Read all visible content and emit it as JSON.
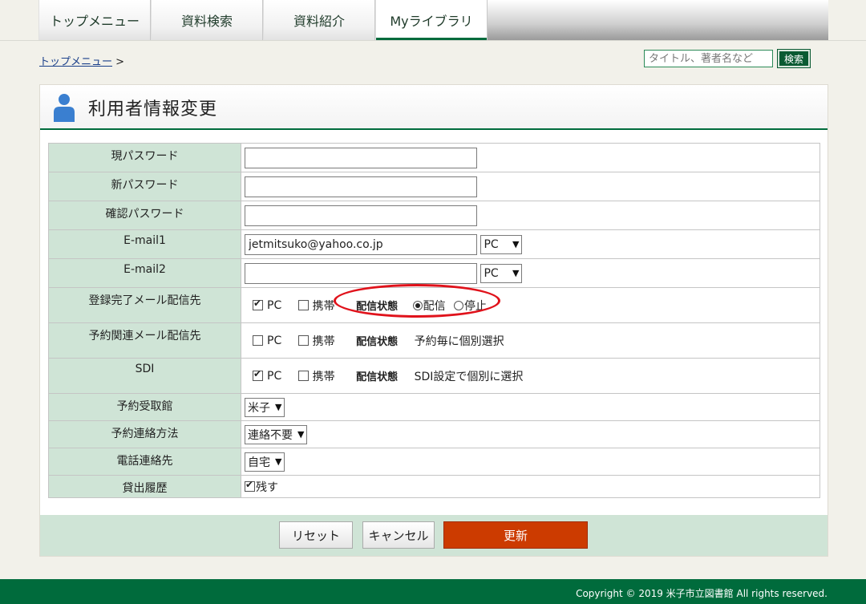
{
  "nav": {
    "tabs": [
      {
        "label": "トップメニュー"
      },
      {
        "label": "資料検索"
      },
      {
        "label": "資料紹介"
      },
      {
        "label": "Myライブラリ"
      }
    ]
  },
  "breadcrumb": {
    "home": "トップメニュー",
    "sep": ">"
  },
  "search": {
    "placeholder": "タイトル、著者名など",
    "button": "検索"
  },
  "page": {
    "title": "利用者情報変更"
  },
  "form": {
    "current_password": {
      "label": "現パスワード",
      "value": ""
    },
    "new_password": {
      "label": "新パスワード",
      "value": ""
    },
    "confirm_password": {
      "label": "確認パスワード",
      "value": ""
    },
    "email1": {
      "label": "E-mail1",
      "value": "jetmitsuko@yahoo.co.jp",
      "type": "PC"
    },
    "email2": {
      "label": "E-mail2",
      "value": "",
      "type": "PC"
    },
    "reg_mail": {
      "label": "登録完了メール配信先",
      "pc": "PC",
      "pc_checked": true,
      "mobile": "携帯",
      "mobile_checked": false,
      "status_label": "配信状態",
      "opt_on": "配信",
      "opt_off": "停止",
      "selected": "配信"
    },
    "reserve_mail": {
      "label": "予約関連メール配信先",
      "pc": "PC",
      "mobile": "携帯",
      "status_label": "配信状態",
      "status_text": "予約毎に個別選択"
    },
    "sdi": {
      "label": "SDI",
      "pc": "PC",
      "mobile": "携帯",
      "status_label": "配信状態",
      "status_text": "SDI設定で個別に選択"
    },
    "pickup_library": {
      "label": "予約受取館",
      "value": "米子"
    },
    "contact_method": {
      "label": "予約連絡方法",
      "value": "連絡不要"
    },
    "phone_contact": {
      "label": "電話連絡先",
      "value": "自宅"
    },
    "loan_history": {
      "label": "貸出履歴",
      "option": "残す",
      "checked": true
    }
  },
  "buttons": {
    "reset": "リセット",
    "cancel": "キャンセル",
    "update": "更新"
  },
  "footer": {
    "copyright": "Copyright © 2019 米子市立図書館 All rights reserved."
  },
  "colors": {
    "brand_green": "#006b3c",
    "label_bg": "#cfe4d6",
    "update_button": "#cc3b00",
    "highlight": "#e0121b"
  }
}
